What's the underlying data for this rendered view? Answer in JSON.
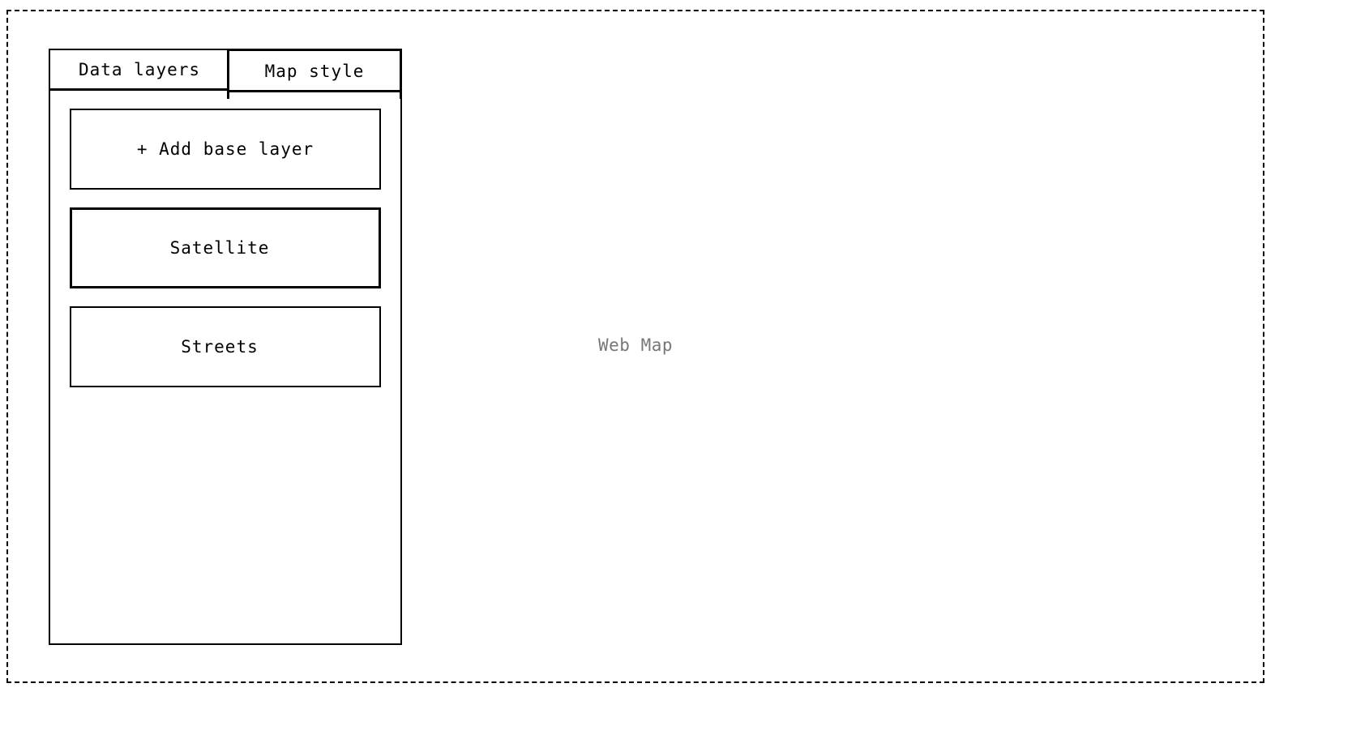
{
  "map": {
    "label": "Web Map"
  },
  "tabs": [
    {
      "label": "Data layers",
      "active": false
    },
    {
      "label": "Map style",
      "active": true
    }
  ],
  "base_layers": {
    "add_label": "+ Add base layer",
    "items": [
      {
        "label": "Satellite",
        "selected": true
      },
      {
        "label": "Streets",
        "selected": false
      }
    ]
  },
  "colors": {
    "border": "#000000",
    "background": "#ffffff",
    "map_label": "#777777"
  }
}
